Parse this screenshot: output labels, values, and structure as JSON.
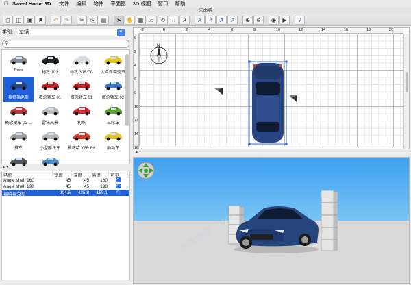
{
  "menubar": {
    "app_name": "Sweet Home 3D",
    "items": [
      "文件",
      "编辑",
      "物件",
      "平面图",
      "3D 视图",
      "窗口",
      "帮助"
    ]
  },
  "window": {
    "title": "未命名"
  },
  "toolbar": {
    "icons": [
      "new-icon",
      "open-icon",
      "save-icon",
      "add-furniture-icon",
      "undo-icon",
      "redo-icon",
      "cut-icon",
      "copy-icon",
      "paste-icon",
      "select-mode-icon",
      "pan-mode-icon",
      "create-walls-icon",
      "create-rooms-icon",
      "create-polylines-icon",
      "create-dimensions-icon",
      "create-labels-icon",
      "increase-text-icon",
      "decrease-text-icon",
      "bold-text-icon",
      "italic-text-icon",
      "zoom-in-icon",
      "zoom-out-icon",
      "create-photo-icon",
      "create-video-icon",
      "help-icon"
    ]
  },
  "catalog": {
    "category_label": "类别:",
    "category_value": "车辆",
    "search_placeholder": "",
    "items": [
      {
        "label": "Truck",
        "color": "#8a8d93"
      },
      {
        "label": "标致 103",
        "color": "#222222"
      },
      {
        "label": "标致 308 CC",
        "color": "#dcdcdc"
      },
      {
        "label": "大众新甲壳虫",
        "color": "#e8c21c"
      },
      {
        "label": "福特福克斯",
        "color": "#27457d"
      },
      {
        "label": "概念轿车 01",
        "color": "#c51f1f"
      },
      {
        "label": "概念轿车 01",
        "color": "#c51f1f"
      },
      {
        "label": "概念轿车 02",
        "color": "#3a74c9"
      },
      {
        "label": "概念轿车 02 ...",
        "color": "#b5353a"
      },
      {
        "label": "雷诺风景",
        "color": "#b9b9b9"
      },
      {
        "label": "利燕",
        "color": "#c22b2b"
      },
      {
        "label": "三轮车",
        "color": "#5aa02c"
      },
      {
        "label": "推车",
        "color": "#9e9e9e"
      },
      {
        "label": "小型摩托车",
        "color": "#b8b8b8"
      },
      {
        "label": "雅马哈 YZR R6",
        "color": "#d23a2a"
      },
      {
        "label": "助动车",
        "color": "#e1c62b"
      },
      {
        "label": "",
        "color": "#555555"
      },
      {
        "label": "",
        "color": "#4a8ac4"
      }
    ],
    "selected_index": 4
  },
  "furniture_table": {
    "columns": [
      "名称",
      "宽度",
      "深度",
      "高度",
      "可见"
    ],
    "rows": [
      {
        "name": "Angle shelf 160",
        "width": "45",
        "depth": "45",
        "height": "160",
        "visible": true
      },
      {
        "name": "Angle shelf 198",
        "width": "45",
        "depth": "45",
        "height": "198",
        "visible": true
      },
      {
        "name": "福特福克斯",
        "width": "204.5",
        "depth": "435.8",
        "height": "155.1",
        "visible": true
      }
    ],
    "selected_row": 2
  },
  "plan": {
    "ruler_h": [
      "-2",
      "0",
      "2",
      "4",
      "6",
      "8",
      "10",
      "12",
      "14",
      "16",
      "18",
      "20"
    ],
    "ruler_v": [
      "0",
      "2",
      "4",
      "6",
      "8",
      "10",
      "12",
      "14",
      "16"
    ],
    "compass_label": "N"
  },
  "colors": {
    "selection": "#1e5fd7",
    "car_body": "#27457d",
    "sky_top": "#3ea0f0",
    "ground": "#d9d9d9"
  },
  "watermark": "软件学堂 .com"
}
